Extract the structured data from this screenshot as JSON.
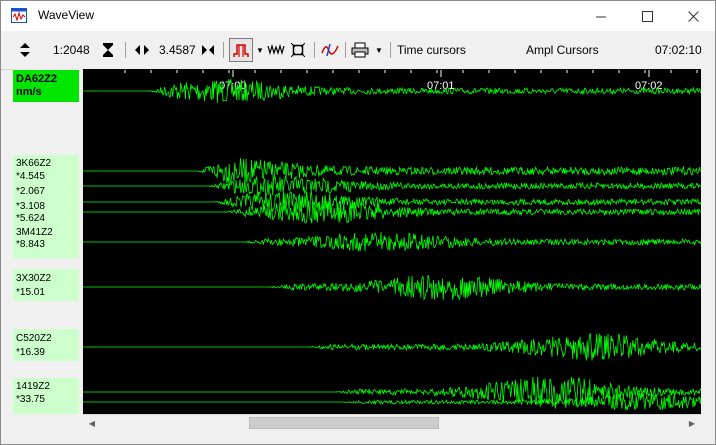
{
  "window": {
    "title": "WaveView"
  },
  "toolbar": {
    "scale_value": "1:2048",
    "gain_value": "3.4587",
    "time_cursors_label": "Time cursors",
    "ampl_cursors_label": "Ampl Cursors",
    "clock": "07:02:10"
  },
  "time_axis": [
    "07:00",
    "07:01",
    "07:02"
  ],
  "channels": [
    {
      "name": "DA62Z2",
      "value": "nm/s",
      "active": true
    },
    {
      "name": "3K66Z2",
      "value": "*4.545"
    },
    {
      "name": "",
      "value": "*2.067"
    },
    {
      "name": "",
      "value": "*3.108"
    },
    {
      "name": "",
      "value": "*5.624"
    },
    {
      "name": "3M41Z2",
      "value": "*8.843"
    },
    {
      "name": "3X30Z2",
      "value": "*15.01"
    },
    {
      "name": "C520Z2",
      "value": "*16.39"
    },
    {
      "name": "1419Z2",
      "value": "*33.75"
    }
  ],
  "colors": {
    "trace": "#00ff00",
    "plot_bg": "#000000",
    "label_bg": "#ccffcc",
    "active_label_bg": "#00e600"
  },
  "icons": [
    "waveview-app-icon",
    "vertical-zoom-icon",
    "time-compress-icon",
    "horizontal-shift-icon",
    "filter-icon",
    "autoscale-icon",
    "fit-window-icon",
    "spectrum-icon",
    "print-icon"
  ]
}
